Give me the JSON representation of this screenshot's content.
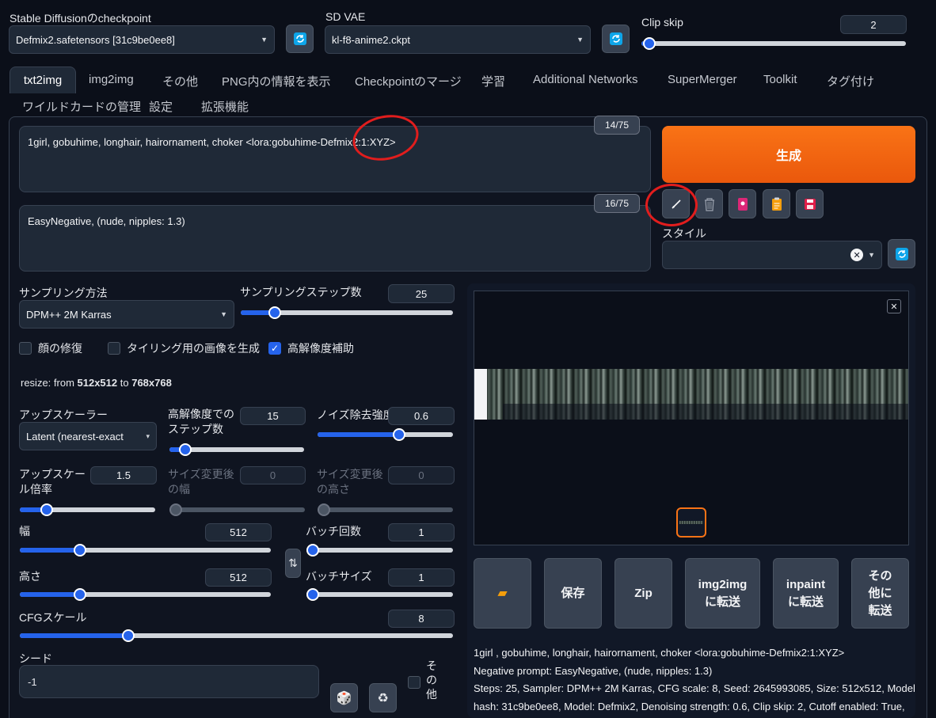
{
  "top": {
    "checkpoint_label": "Stable Diffusionのcheckpoint",
    "checkpoint_value": "Defmix2.safetensors [31c9be0ee8]",
    "vae_label": "SD VAE",
    "vae_value": "kl-f8-anime2.ckpt",
    "clipskip_label": "Clip skip",
    "clipskip_value": "2",
    "clipskip_fraction": 0.03
  },
  "tabs": [
    "txt2img",
    "img2img",
    "その他",
    "PNG内の情報を表示",
    "Checkpointのマージ",
    "学習",
    "Additional Networks",
    "SuperMerger",
    "Toolkit",
    "タグ付け",
    "ワイルドカードの管理",
    "設定",
    "拡張機能"
  ],
  "prompt": {
    "positive": "1girl, gobuhime, longhair, hairornament, choker <lora:gobuhime-Defmix2:1:XYZ>",
    "positive_count": "14/75",
    "negative": "EasyNegative, (nude, nipples: 1.3)",
    "negative_count": "16/75"
  },
  "generate_label": "生成",
  "style_label": "スタイル",
  "sampling": {
    "method_label": "サンプリング方法",
    "method_value": "DPM++ 2M Karras",
    "steps_label": "サンプリングステップ数",
    "steps_value": "25",
    "steps_fraction": 0.16
  },
  "checks": {
    "face": "顔の修復",
    "tiling": "タイリング用の画像を生成",
    "hires": "高解像度補助"
  },
  "resize_text": {
    "prefix": "resize: from ",
    "from": "512x512",
    "mid": " to ",
    "to": "768x768"
  },
  "hires": {
    "upscaler_label": "アップスケーラー",
    "upscaler_value": "Latent (nearest-exact",
    "steps_label": "高解像度でのステップ数",
    "steps_value": "15",
    "denoise_label": "ノイズ除去強度",
    "denoise_value": "0.6",
    "scale_label": "アップスケール倍率",
    "scale_value": "1.5",
    "resize_w_label": "サイズ変更後の幅",
    "resize_w_value": "0",
    "resize_h_label": "サイズ変更後の高さ",
    "resize_h_value": "0"
  },
  "size": {
    "width_label": "幅",
    "width_value": "512",
    "height_label": "高さ",
    "height_value": "512",
    "batch_count_label": "バッチ回数",
    "batch_count_value": "1",
    "batch_size_label": "バッチサイズ",
    "batch_size_value": "1"
  },
  "cfg": {
    "label": "CFGスケール",
    "value": "8"
  },
  "seed": {
    "label": "シード",
    "value": "-1",
    "extra_label": "その他"
  },
  "actions": {
    "save": "保存",
    "zip": "Zip",
    "img2img": "img2img に転送",
    "inpaint": "inpaint に転送",
    "other": "その 他に 転送"
  },
  "info": {
    "line1": "1girl , gobuhime, longhair, hairornament, choker <lora:gobuhime-Defmix2:1:XYZ>",
    "line2": "Negative prompt: EasyNegative, (nude, nipples: 1.3)",
    "line3": "Steps: 25, Sampler: DPM++ 2M Karras, CFG scale: 8, Seed: 2645993085, Size: 512x512, Model",
    "line4": "hash: 31c9be0ee8, Model: Defmix2, Denoising strength: 0.6, Clip skip: 2, Cutoff enabled: True,"
  },
  "colors": {
    "accent": "#2563eb",
    "generate": "#ea580c",
    "annotation": "#e11d1d",
    "background": "#0b0f19"
  }
}
